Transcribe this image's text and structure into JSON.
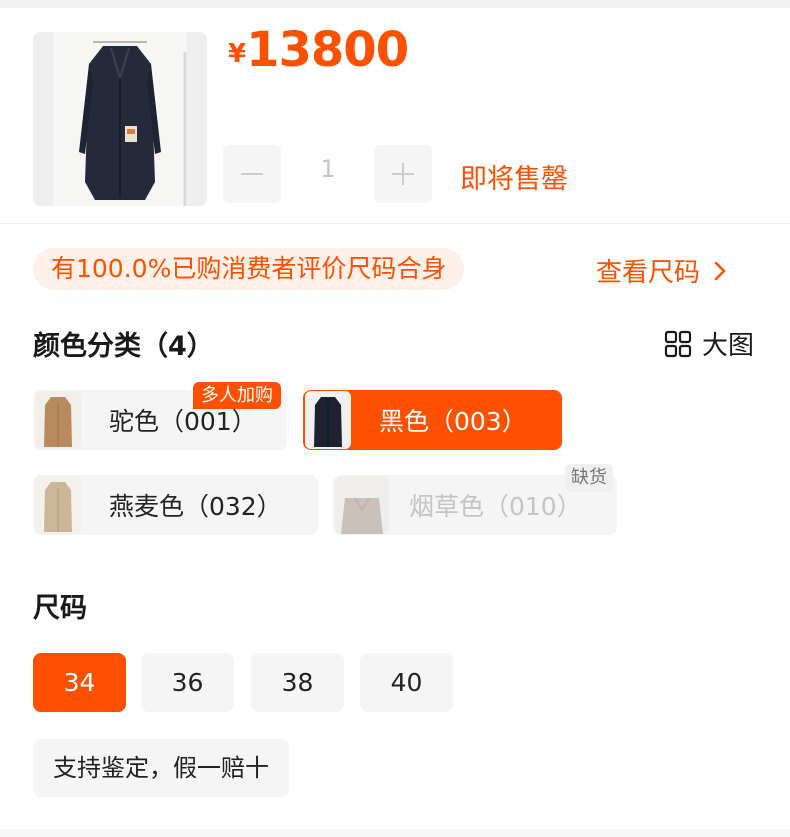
{
  "product": {
    "price_symbol": "¥",
    "price": "13800",
    "quantity": "1",
    "stock_status": "即将售罄"
  },
  "fit": {
    "text": "有100.0%已购消费者评价尺码合身",
    "size_guide_label": "查看尺码"
  },
  "colors": {
    "title": "颜色分类（4）",
    "big_view_label": "大图",
    "options": [
      {
        "label": "驼色（001）",
        "badge": "多人加购",
        "state": "normal",
        "swatch": "#b88a5e"
      },
      {
        "label": "黑色（003）",
        "state": "selected",
        "swatch": "#1e2230"
      },
      {
        "label": "燕麦色（032）",
        "state": "normal",
        "swatch": "#cdb59a"
      },
      {
        "label": "烟草色（010）",
        "badge": "缺货",
        "state": "disabled",
        "swatch": "#a8988a"
      }
    ]
  },
  "sizes": {
    "title": "尺码",
    "options": [
      "34",
      "36",
      "38",
      "40"
    ],
    "selected": "34"
  },
  "guarantee": "支持鉴定，假一赔十",
  "theme": {
    "accent": "#ff5000",
    "pill_bg": "#fff0ea",
    "chip_bg": "#f5f5f5"
  },
  "icons": {
    "minus": "minus-icon",
    "plus": "plus-icon",
    "chevron": "chevron-right-icon",
    "grid": "grid-icon"
  }
}
